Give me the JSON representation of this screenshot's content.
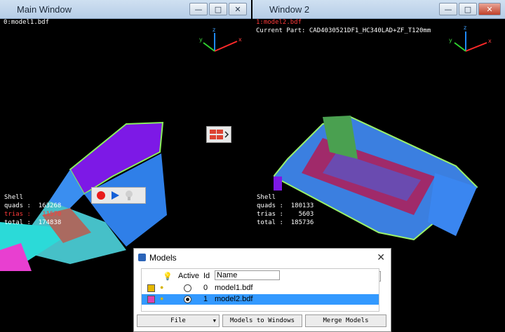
{
  "main_window": {
    "title": "Main Window",
    "model_label": "0:model1.bdf",
    "stats": {
      "heading": "Shell",
      "quads": "quads :  163268",
      "trias": "trias :   11570",
      "total": "total :  174838"
    }
  },
  "window2": {
    "title": "Window 2",
    "model_label": "1:model2.bdf",
    "current_part": "Current Part: CAD4030521DF1_HC340LAD+ZF_T120mm",
    "stats": {
      "heading": "Shell",
      "quads": "quads :  180133",
      "trias": "trias :    5603",
      "total": "total :  185736"
    }
  },
  "window_buttons": {
    "minimize": "—",
    "maximize": "□",
    "close": "✕"
  },
  "axes": {
    "x": "x",
    "y": "y",
    "z": "z"
  },
  "models_dialog": {
    "title": "Models",
    "columns": {
      "active": "Active",
      "id": "Id",
      "name": "Name"
    },
    "rows": [
      {
        "id": "0",
        "name": "model1.bdf",
        "color": "#e6b800",
        "active": false
      },
      {
        "id": "1",
        "name": "model2.bdf",
        "color": "#e040b0",
        "active": true
      }
    ],
    "buttons": {
      "file": "File",
      "models_to_windows": "Models to Windows",
      "merge_models": "Merge Models"
    }
  },
  "colors": {
    "selected_row": "#3399ff",
    "title_bar": "#b6cde7",
    "close_btn": "#c0412a"
  }
}
